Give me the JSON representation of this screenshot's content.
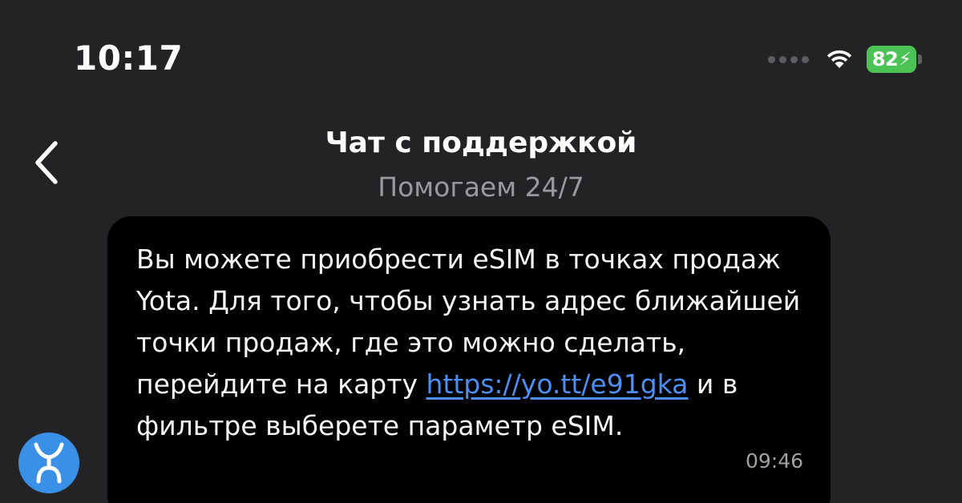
{
  "status_bar": {
    "time": "10:17",
    "battery_level": "82",
    "battery_charging": true,
    "battery_color": "#4cc455"
  },
  "header": {
    "back_icon": "chevron-left-icon",
    "title": "Чат с поддержкой",
    "subtitle": "Помогаем 24/7"
  },
  "message": {
    "text_before_link": "Вы можете приобрести eSIM в точках продаж Yota. Для того, чтобы узнать адрес ближайшей точки продаж, где это можно сделать, перейдите на карту ",
    "link_text": "https://yo.tt/e91gka",
    "text_after_link": " и в фильтре выберете параметр eSIM.",
    "time": "09:46",
    "link_color": "#4b8ff5"
  },
  "avatar": {
    "icon": "yota-logo-icon",
    "background_color": "#3a8fe6"
  }
}
